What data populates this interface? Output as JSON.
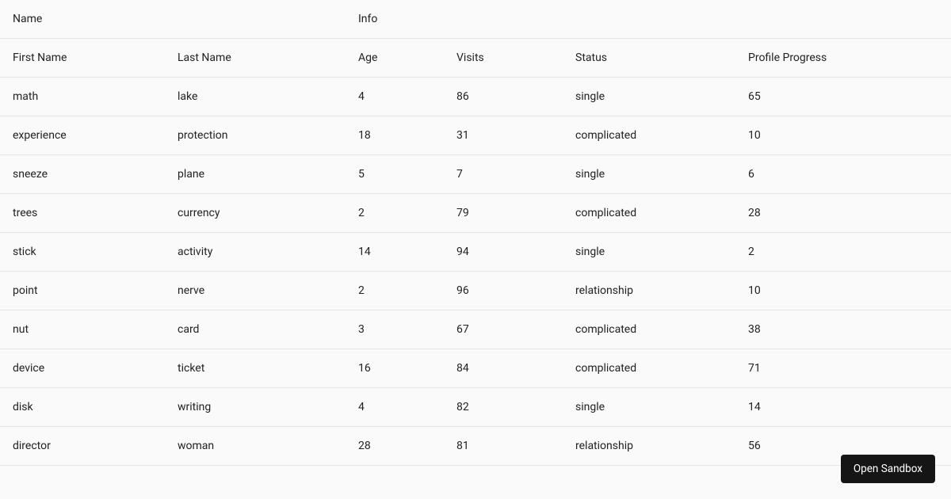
{
  "table": {
    "group_headers": {
      "name": "Name",
      "info": "Info"
    },
    "columns": {
      "first_name": "First Name",
      "last_name": "Last Name",
      "age": "Age",
      "visits": "Visits",
      "status": "Status",
      "progress": "Profile Progress"
    },
    "rows": [
      {
        "first_name": "math",
        "last_name": "lake",
        "age": 4,
        "visits": 86,
        "status": "single",
        "progress": 65
      },
      {
        "first_name": "experience",
        "last_name": "protection",
        "age": 18,
        "visits": 31,
        "status": "complicated",
        "progress": 10
      },
      {
        "first_name": "sneeze",
        "last_name": "plane",
        "age": 5,
        "visits": 7,
        "status": "single",
        "progress": 6
      },
      {
        "first_name": "trees",
        "last_name": "currency",
        "age": 2,
        "visits": 79,
        "status": "complicated",
        "progress": 28
      },
      {
        "first_name": "stick",
        "last_name": "activity",
        "age": 14,
        "visits": 94,
        "status": "single",
        "progress": 2
      },
      {
        "first_name": "point",
        "last_name": "nerve",
        "age": 2,
        "visits": 96,
        "status": "relationship",
        "progress": 10
      },
      {
        "first_name": "nut",
        "last_name": "card",
        "age": 3,
        "visits": 67,
        "status": "complicated",
        "progress": 38
      },
      {
        "first_name": "device",
        "last_name": "ticket",
        "age": 16,
        "visits": 84,
        "status": "complicated",
        "progress": 71
      },
      {
        "first_name": "disk",
        "last_name": "writing",
        "age": 4,
        "visits": 82,
        "status": "single",
        "progress": 14
      },
      {
        "first_name": "director",
        "last_name": "woman",
        "age": 28,
        "visits": 81,
        "status": "relationship",
        "progress": 56
      }
    ]
  },
  "buttons": {
    "open_sandbox": "Open Sandbox"
  }
}
